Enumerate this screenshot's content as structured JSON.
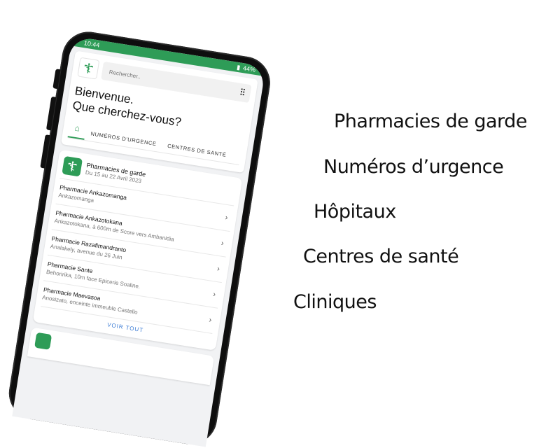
{
  "status_bar": {
    "time": "10:44",
    "battery": "44%"
  },
  "search": {
    "placeholder": "Rechercher.."
  },
  "welcome": {
    "line1": "Bienvenue.",
    "line2": "Que cherchez-vous?"
  },
  "tabs": [
    {
      "label": "NUMÉROS D'URGENCE"
    },
    {
      "label": "CENTRES DE SANTÉ"
    }
  ],
  "card": {
    "title": "Pharmacies de garde",
    "subtitle": "Du 15 au 22 Avril 2023",
    "items": [
      {
        "name": "Pharmacie Ankazomanga",
        "address": "Ankazomanga"
      },
      {
        "name": "Pharmacie Ankazotokana",
        "address": "Ankazotokana, à 600m de Score vers Ambanidia"
      },
      {
        "name": "Pharmacie Razafimandranto",
        "address": "Analakely, avenue du 26 Juin"
      },
      {
        "name": "Pharmacie Sante",
        "address": "Behoririka, 10m face Epicerie Soaline."
      },
      {
        "name": "Pharmacie Maevasoa",
        "address": "Anosizato, enceinte immeuble Castello"
      }
    ],
    "see_all": "VOIR TOUT"
  },
  "features": [
    "Pharmacies de garde",
    "Numéros d’urgence",
    "Hôpitaux",
    "Centres de santé",
    "Cliniques"
  ],
  "colors": {
    "brand_green": "#2e9c57",
    "link_blue": "#3a7bd5"
  },
  "icons": {
    "logo": "caduceus-icon",
    "filter": "sliders-icon",
    "home": "home-icon",
    "chevron": "chevron-right-icon"
  }
}
